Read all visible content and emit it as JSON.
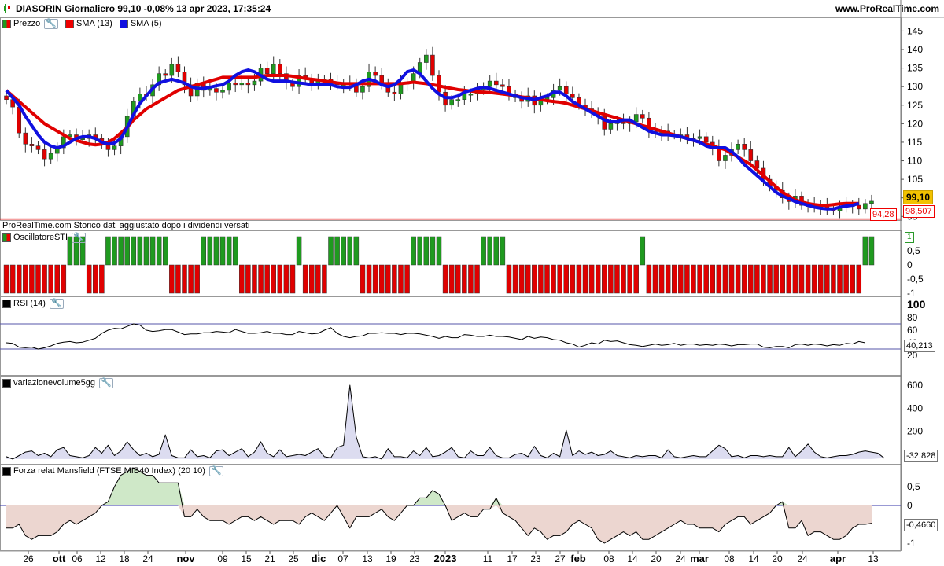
{
  "header": {
    "title": "DIASORIN Giornaliero 99,10 -0,08% 13 apr 2023, 17:35:24",
    "site": "www.ProRealTime.com"
  },
  "legend": {
    "price": "Prezzo",
    "sma13": "SMA (13)",
    "sma5": "SMA (5)",
    "sti": "OscillatoreSTI",
    "rsi": "RSI (14)",
    "vol": "variazionevolume5gg",
    "mans": "Forza relat Mansfield (FTSE MIB40 Index) (20 10)"
  },
  "note": "ProRealTime.com  Storico dati aggiustato dopo i dividendi versati",
  "tags": {
    "last": "99,10",
    "sma13": "98,507",
    "low": "94,28",
    "rsi": "40,213",
    "vol": "-32,828",
    "mans": "-0,4660",
    "sti": "1"
  },
  "colors": {
    "up": "#1f9a1f",
    "down": "#e00000",
    "sma13": "#e00000",
    "sma5": "#1010e0",
    "grid": "#777777",
    "vol_fill": "#dcdcf0",
    "mans_pos": "#cfe8c8",
    "mans_neg": "#ecd6d0"
  },
  "chart_data": {
    "type": "candlestick",
    "x_labels": [
      "26",
      "ott",
      "06",
      "12",
      "18",
      "24",
      "nov",
      "09",
      "15",
      "21",
      "25",
      "dic",
      "07",
      "13",
      "19",
      "23",
      "2023",
      "11",
      "17",
      "23",
      "27",
      "feb",
      "08",
      "14",
      "20",
      "24",
      "mar",
      "08",
      "14",
      "20",
      "24",
      "apr",
      "13"
    ],
    "price_axis": {
      "ticks": [
        95,
        100,
        105,
        110,
        115,
        120,
        125,
        130,
        135,
        140,
        145
      ],
      "range": [
        94,
        147
      ]
    },
    "closes": [
      126.5,
      124.5,
      117.5,
      114.5,
      114.0,
      113.0,
      110.5,
      112.0,
      113.5,
      116.5,
      117.0,
      116.0,
      116.0,
      117.0,
      116.0,
      114.5,
      113.0,
      114.0,
      116.5,
      122.0,
      126.0,
      128.0,
      127.5,
      130.5,
      133.5,
      133.0,
      136.0,
      134.0,
      130.5,
      127.5,
      131.0,
      129.0,
      129.5,
      128.5,
      129.0,
      131.0,
      130.5,
      131.0,
      130.5,
      131.5,
      135.0,
      133.5,
      136.0,
      133.5,
      131.0,
      130.0,
      133.0,
      132.0,
      131.0,
      131.5,
      132.0,
      131.0,
      130.5,
      130.5,
      131.0,
      128.5,
      130.0,
      134.0,
      133.0,
      131.0,
      128.5,
      128.0,
      131.0,
      131.0,
      133.5,
      136.5,
      138.5,
      133.0,
      128.5,
      125.0,
      126.5,
      126.5,
      128.0,
      128.0,
      129.0,
      130.0,
      131.5,
      130.5,
      130.0,
      128.0,
      127.0,
      126.0,
      127.5,
      125.0,
      126.5,
      127.0,
      129.0,
      130.0,
      128.0,
      127.0,
      125.0,
      124.0,
      123.0,
      122.0,
      118.5,
      120.0,
      120.5,
      120.0,
      120.5,
      122.5,
      121.5,
      118.0,
      117.5,
      118.0,
      117.0,
      117.0,
      117.0,
      116.0,
      116.0,
      116.5,
      115.0,
      113.5,
      110.0,
      111.5,
      113.0,
      114.5,
      113.0,
      110.0,
      108.0,
      105.0,
      103.0,
      102.0,
      100.0,
      99.0,
      100.5,
      98.0,
      98.0,
      97.5,
      98.0,
      97.0,
      96.5,
      97.5,
      98.0,
      98.0,
      97.0,
      98.5,
      99.1
    ],
    "sma13": [
      129.0,
      127.5,
      126.0,
      124.5,
      123.0,
      121.5,
      120.0,
      119.0,
      118.0,
      117.0,
      116.0,
      115.5,
      115.0,
      114.5,
      114.3,
      114.5,
      115.0,
      116.0,
      117.5,
      119.0,
      121.0,
      122.5,
      124.0,
      125.0,
      126.0,
      127.0,
      128.0,
      129.0,
      129.5,
      130.0,
      130.5,
      131.0,
      131.5,
      132.0,
      132.5,
      132.5,
      132.5,
      132.5,
      132.5,
      132.5,
      132.8,
      133.0,
      133.0,
      133.0,
      133.0,
      132.8,
      132.5,
      132.2,
      132.0,
      131.8,
      131.5,
      131.3,
      131.0,
      130.8,
      130.8,
      130.8,
      130.8,
      130.8,
      130.8,
      130.8,
      130.8,
      130.8,
      130.8,
      131.0,
      131.2,
      131.0,
      130.8,
      130.5,
      130.2,
      129.8,
      129.5,
      129.2,
      129.0,
      128.8,
      128.6,
      128.5,
      128.4,
      128.2,
      128.0,
      127.8,
      127.5,
      127.2,
      127.0,
      126.8,
      126.5,
      126.2,
      126.0,
      125.8,
      125.5,
      125.0,
      124.5,
      124.0,
      123.5,
      123.0,
      122.5,
      122.0,
      121.5,
      121.0,
      120.5,
      120.0,
      119.5,
      119.0,
      118.5,
      118.0,
      117.5,
      117.0,
      116.5,
      116.0,
      115.5,
      115.0,
      114.5,
      114.0,
      113.5,
      113.0,
      112.0,
      111.0,
      110.0,
      109.0,
      107.5,
      106.0,
      104.5,
      103.0,
      101.5,
      100.5,
      99.5,
      98.9,
      98.5,
      98.2,
      98.0,
      98.0,
      98.2,
      98.4,
      98.5,
      98.5,
      98.5
    ],
    "sma5": [
      129.0,
      127.0,
      125.0,
      122.0,
      119.5,
      117.0,
      115.0,
      114.0,
      113.5,
      114.0,
      115.0,
      116.0,
      116.5,
      116.5,
      116.0,
      115.0,
      114.5,
      114.8,
      116.0,
      119.0,
      122.5,
      125.5,
      127.5,
      129.5,
      131.0,
      131.5,
      132.0,
      131.5,
      131.0,
      130.0,
      129.5,
      129.5,
      129.8,
      130.2,
      130.5,
      131.5,
      133.0,
      134.0,
      134.5,
      134.0,
      133.0,
      132.0,
      131.5,
      131.5,
      131.5,
      131.2,
      131.0,
      130.8,
      130.5,
      130.5,
      130.5,
      130.5,
      130.0,
      129.8,
      129.8,
      130.5,
      131.5,
      132.0,
      131.5,
      130.5,
      130.0,
      130.5,
      132.0,
      134.0,
      134.5,
      133.5,
      131.5,
      129.5,
      128.0,
      127.0,
      127.0,
      127.5,
      128.5,
      129.0,
      129.5,
      129.8,
      129.5,
      129.0,
      128.5,
      128.0,
      127.5,
      127.0,
      126.8,
      126.5,
      127.0,
      127.5,
      128.5,
      128.5,
      127.5,
      126.0,
      125.0,
      124.0,
      123.0,
      122.0,
      121.0,
      120.5,
      120.5,
      121.0,
      121.0,
      120.0,
      119.0,
      118.0,
      117.5,
      117.0,
      117.0,
      116.8,
      116.5,
      116.0,
      115.5,
      115.0,
      114.0,
      113.5,
      113.5,
      113.5,
      112.5,
      111.0,
      109.0,
      107.5,
      106.0,
      104.5,
      103.0,
      101.5,
      100.5,
      99.8,
      99.0,
      98.5,
      98.0,
      97.5,
      97.2,
      97.0,
      97.0,
      97.5,
      97.8,
      98.0,
      98.5
    ],
    "sti": [
      -1,
      -1,
      -1,
      -1,
      -1,
      -1,
      -1,
      -1,
      -1,
      -1,
      1,
      1,
      1,
      -1,
      -1,
      -1,
      1,
      1,
      1,
      1,
      1,
      1,
      1,
      1,
      1,
      1,
      -1,
      -1,
      -1,
      -1,
      -1,
      1,
      1,
      1,
      1,
      1,
      1,
      -1,
      -1,
      -1,
      -1,
      -1,
      -1,
      -1,
      -1,
      -1,
      1,
      -1,
      -1,
      -1,
      -1,
      1,
      1,
      1,
      1,
      1,
      -1,
      -1,
      -1,
      -1,
      -1,
      -1,
      -1,
      -1,
      1,
      1,
      1,
      1,
      1,
      -1,
      -1,
      -1,
      -1,
      -1,
      -1,
      1,
      1,
      1,
      1,
      -1,
      -1,
      -1,
      -1,
      -1,
      -1,
      -1,
      -1,
      -1,
      -1,
      -1,
      -1,
      -1,
      -1,
      -1,
      -1,
      -1,
      -1,
      -1,
      -1,
      -1,
      1,
      -1,
      -1,
      -1,
      -1,
      -1,
      -1,
      -1,
      -1,
      -1,
      -1,
      -1,
      -1,
      -1,
      -1,
      -1,
      -1,
      -1,
      -1,
      -1,
      -1,
      -1,
      -1,
      -1,
      -1,
      -1,
      -1,
      -1,
      -1,
      -1,
      -1,
      -1,
      -1,
      -1,
      -1,
      1,
      1
    ],
    "rsi_axis": {
      "ticks": [
        20,
        40,
        60,
        80,
        100
      ],
      "levels": [
        30,
        70
      ]
    },
    "rsi": [
      40,
      39,
      33,
      32,
      33,
      30,
      32,
      35,
      39,
      41,
      42,
      40,
      41,
      44,
      47,
      55,
      60,
      63,
      62,
      66,
      70,
      68,
      60,
      58,
      59,
      61,
      61,
      57,
      53,
      54,
      54,
      56,
      56,
      58,
      57,
      56,
      61,
      58,
      55,
      55,
      56,
      58,
      55,
      55,
      53,
      53,
      58,
      56,
      54,
      55,
      60,
      64,
      55,
      50,
      48,
      50,
      51,
      55,
      55,
      56,
      55,
      55,
      53,
      55,
      55,
      54,
      52,
      50,
      47,
      50,
      48,
      48,
      53,
      52,
      50,
      50,
      52,
      50,
      50,
      49,
      47,
      45,
      50,
      47,
      49,
      48,
      45,
      44,
      40,
      38,
      33,
      36,
      40,
      38,
      44,
      42,
      43,
      40,
      37,
      36,
      34,
      36,
      38,
      36,
      37,
      39,
      36,
      38,
      38,
      36,
      37,
      36,
      38,
      37,
      35,
      37,
      37,
      38,
      38,
      33,
      32,
      34,
      34,
      32,
      37,
      38,
      36,
      38,
      37,
      35,
      37,
      36,
      39,
      38,
      42,
      40
    ],
    "vol_axis": {
      "ticks": [
        0,
        200,
        400,
        600
      ]
    },
    "vol": [
      -20,
      -40,
      -10,
      20,
      30,
      -10,
      10,
      -20,
      40,
      60,
      -10,
      -20,
      -30,
      -10,
      60,
      10,
      80,
      -10,
      30,
      110,
      40,
      -10,
      10,
      -20,
      0,
      170,
      -10,
      -30,
      -30,
      40,
      -20,
      -10,
      -30,
      30,
      40,
      -10,
      20,
      50,
      -20,
      20,
      110,
      10,
      -20,
      40,
      -20,
      -10,
      0,
      -10,
      20,
      50,
      -20,
      -30,
      60,
      80,
      600,
      150,
      -20,
      -30,
      -20,
      -40,
      50,
      -20,
      -20,
      -30,
      30,
      -10,
      60,
      -20,
      -10,
      20,
      60,
      -20,
      -30,
      30,
      -10,
      -10,
      60,
      -10,
      -30,
      -30,
      0,
      10,
      -20,
      70,
      -10,
      -30,
      10,
      -20,
      210,
      -10,
      30,
      0,
      20,
      -10,
      0,
      30,
      -10,
      -20,
      -30,
      -10,
      -20,
      -10,
      -10,
      -30,
      40,
      -20,
      -30,
      -20,
      -10,
      -20,
      -20,
      30,
      80,
      50,
      -20,
      -10,
      -30,
      -10,
      -10,
      -20,
      -10,
      -20,
      -20,
      60,
      -20,
      30,
      90,
      20,
      -20,
      -30,
      -20,
      -10,
      -10,
      0,
      20,
      30,
      20,
      10,
      -33
    ],
    "mans_axis": {
      "ticks": [
        -1,
        0,
        0.5
      ]
    },
    "mans": [
      -0.6,
      -0.6,
      -0.5,
      -0.8,
      -0.9,
      -0.8,
      -0.8,
      -0.8,
      -0.7,
      -0.5,
      -0.4,
      -0.5,
      -0.4,
      -0.3,
      -0.2,
      0.0,
      0.1,
      0.5,
      0.8,
      0.9,
      1.0,
      0.9,
      0.8,
      0.8,
      0.6,
      0.6,
      0.6,
      0.6,
      -0.3,
      -0.3,
      -0.1,
      -0.3,
      -0.4,
      -0.4,
      -0.4,
      -0.5,
      -0.4,
      -0.3,
      -0.3,
      -0.4,
      -0.3,
      -0.4,
      -0.5,
      -0.4,
      -0.4,
      -0.4,
      -0.5,
      -0.3,
      -0.2,
      -0.3,
      -0.4,
      -0.2,
      0.0,
      -0.3,
      -0.6,
      -0.3,
      -0.3,
      -0.3,
      -0.2,
      -0.1,
      -0.3,
      -0.4,
      -0.2,
      0.0,
      0.0,
      0.2,
      0.2,
      0.4,
      0.3,
      0.0,
      -0.4,
      -0.3,
      -0.2,
      -0.3,
      -0.3,
      -0.1,
      -0.1,
      0.2,
      -0.2,
      -0.3,
      -0.4,
      -0.6,
      -0.8,
      -0.6,
      -0.7,
      -0.9,
      -0.8,
      -0.8,
      -0.7,
      -0.5,
      -0.4,
      -0.5,
      -0.6,
      -0.9,
      -1.0,
      -0.9,
      -0.8,
      -0.7,
      -0.8,
      -0.7,
      -0.9,
      -0.9,
      -0.8,
      -0.7,
      -0.6,
      -0.5,
      -0.4,
      -0.5,
      -0.5,
      -0.6,
      -0.6,
      -0.6,
      -0.7,
      -0.5,
      -0.4,
      -0.3,
      -0.3,
      -0.5,
      -0.4,
      -0.3,
      -0.2,
      0.0,
      0.1,
      -0.6,
      -0.6,
      -0.4,
      -0.8,
      -0.7,
      -0.7,
      -0.8,
      -0.9,
      -0.9,
      -0.8,
      -0.6,
      -0.5,
      -0.5,
      -0.47
    ]
  }
}
